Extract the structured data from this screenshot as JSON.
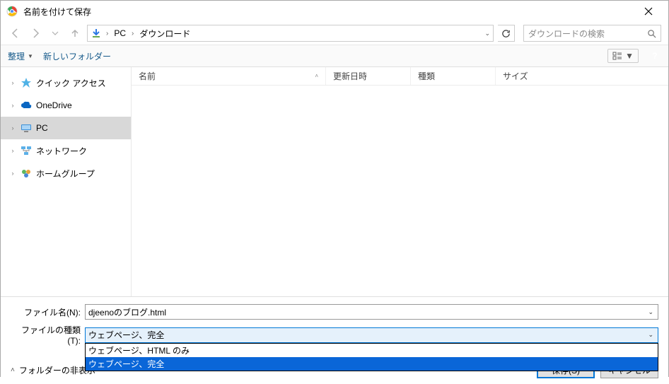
{
  "title": "名前を付けて保存",
  "breadcrumb": {
    "root": "PC",
    "folder": "ダウンロード"
  },
  "search_placeholder": "ダウンロードの検索",
  "toolbar": {
    "organize": "整理",
    "new_folder": "新しいフォルダー"
  },
  "columns": {
    "name": "名前",
    "date": "更新日時",
    "type": "種類",
    "size": "サイズ"
  },
  "tree": {
    "quick_access": "クイック アクセス",
    "onedrive": "OneDrive",
    "pc": "PC",
    "network": "ネットワーク",
    "homegroup": "ホームグループ"
  },
  "form": {
    "filename_label": "ファイル名(N):",
    "filetype_label": "ファイルの種類(T):",
    "filename_value": "djeenoのブログ.html",
    "filetype_value": "ウェブページ、完全",
    "options": [
      "ウェブページ、HTML のみ",
      "ウェブページ、完全"
    ]
  },
  "actions": {
    "hide_folders": "フォルダーの非表示",
    "save": "保存(S)",
    "cancel": "キャンセル"
  }
}
